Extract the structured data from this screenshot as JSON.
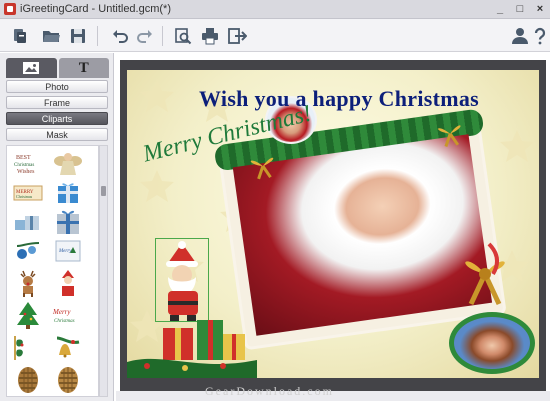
{
  "window": {
    "title": "iGreetingCard - Untitled.gcm(*)",
    "controls": [
      "_",
      "□",
      "×"
    ]
  },
  "toolbar": {
    "buttons": [
      {
        "name": "new-icon"
      },
      {
        "name": "open-folder-icon"
      },
      {
        "name": "save-icon"
      },
      {
        "name": "undo-icon"
      },
      {
        "name": "redo-icon"
      },
      {
        "name": "preview-icon"
      },
      {
        "name": "print-icon"
      },
      {
        "name": "export-icon"
      },
      {
        "name": "account-icon"
      },
      {
        "name": "help-icon"
      }
    ]
  },
  "sidebar": {
    "tabs": [
      {
        "label": "",
        "icon": "image-icon",
        "active": true
      },
      {
        "label": "T",
        "icon": "text-icon",
        "active": false
      }
    ],
    "categories": [
      {
        "label": "Photo",
        "selected": false
      },
      {
        "label": "Frame",
        "selected": false
      },
      {
        "label": "Cliparts",
        "selected": true
      },
      {
        "label": "Mask",
        "selected": false
      }
    ],
    "cliparts": [
      {
        "name": "best-wishes-clipart"
      },
      {
        "name": "angel-clipart"
      },
      {
        "name": "merry-christmas-text-clipart"
      },
      {
        "name": "blue-gift-box-clipart"
      },
      {
        "name": "gift-pile-clipart"
      },
      {
        "name": "silver-gift-box-clipart"
      },
      {
        "name": "blue-ornaments-clipart"
      },
      {
        "name": "christmas-card-clipart"
      },
      {
        "name": "reindeer-clipart"
      },
      {
        "name": "santa-clipart"
      },
      {
        "name": "christmas-tree-clipart"
      },
      {
        "name": "merry-christmas-script-clipart"
      },
      {
        "name": "bells-clipart"
      },
      {
        "name": "holly-corner-clipart"
      },
      {
        "name": "pine-cone-clipart"
      },
      {
        "name": "pine-cone-2-clipart"
      }
    ]
  },
  "card": {
    "headline": "Wish you a happy Christmas",
    "merry_text": "Merry Christmas!"
  },
  "watermark": "GearDownload.com",
  "colors": {
    "headline": "#0c1f7a",
    "merry": "#1f7a3a",
    "selected_category": "#5a5a62"
  }
}
